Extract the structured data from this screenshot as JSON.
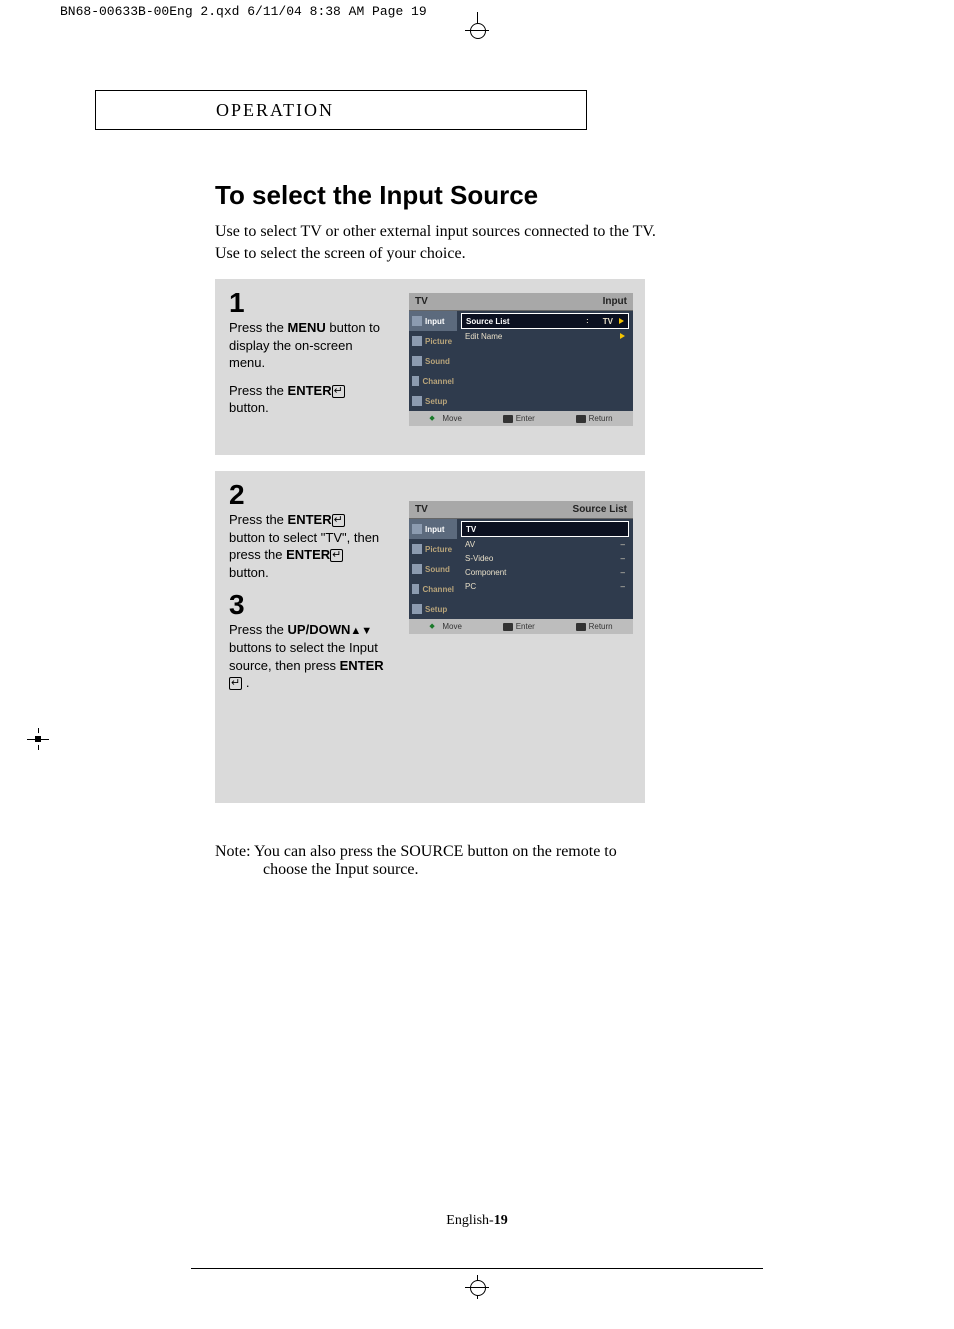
{
  "print_header": "BN68-00633B-00Eng 2.qxd  6/11/04 8:38 AM  Page 19",
  "section_header": "OPERATION",
  "page_title": "To select the Input Source",
  "intro": {
    "line1": "Use to select TV or other external input sources connected to the TV.",
    "line2": "Use to select the screen of your choice."
  },
  "steps": {
    "s1": {
      "num": "1",
      "p1a": "Press the ",
      "p1b": "MENU",
      "p1c": " button to display the on-screen menu.",
      "p2a": "Press the ",
      "p2b": "ENTER",
      "p2c": " button."
    },
    "s2": {
      "num": "2",
      "p1a": "Press the ",
      "p1b": "ENTER",
      "p1c": " button to select \"TV\", then press the ",
      "p1d": "ENTER",
      "p1e": " button."
    },
    "s3": {
      "num": "3",
      "p1a": "Press the ",
      "p1b": "UP/DOWN",
      "p1c": " buttons to select the Input source, then press ",
      "p1d": "ENTER",
      "p1e": " ."
    }
  },
  "osd1": {
    "top_left": "TV",
    "top_right": "Input",
    "side": [
      "Input",
      "Picture",
      "Sound",
      "Channel",
      "Setup"
    ],
    "rows": [
      {
        "label": "Source List",
        "value": "TV",
        "hl": true,
        "tri": true
      },
      {
        "label": "Edit Name",
        "value": "",
        "hl": false,
        "tri": true
      }
    ],
    "foot": {
      "move": "Move",
      "enter": "Enter",
      "return": "Return"
    }
  },
  "osd2": {
    "top_left": "TV",
    "top_right": "Source List",
    "side": [
      "Input",
      "Picture",
      "Sound",
      "Channel",
      "Setup"
    ],
    "rows": [
      {
        "label": "TV",
        "value": "",
        "hl": true
      },
      {
        "label": "AV",
        "value": "–"
      },
      {
        "label": "S-Video",
        "value": "–"
      },
      {
        "label": "Component",
        "value": "–"
      },
      {
        "label": "PC",
        "value": "–"
      }
    ],
    "foot": {
      "move": "Move",
      "enter": "Enter",
      "return": "Return"
    }
  },
  "note": {
    "line1": "Note: You can also press the SOURCE button on the remote to",
    "line2": "choose the Input source."
  },
  "page_number_prefix": "English-",
  "page_number": "19"
}
